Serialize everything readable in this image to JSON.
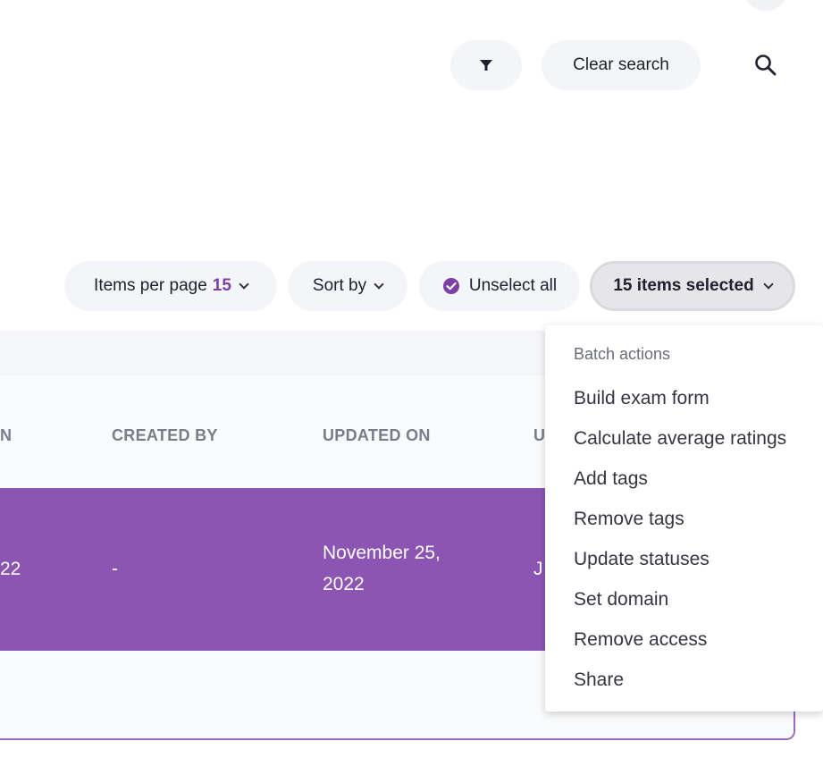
{
  "toolbar": {
    "filter_icon": "filter-icon",
    "clear_label": "Clear search",
    "search_icon": "search-icon"
  },
  "controls": {
    "items_per_page_label": "Items per page",
    "items_per_page_value": "15",
    "sort_label": "Sort by",
    "unselect_label": "Unselect all",
    "selected_label": "15 items selected"
  },
  "table": {
    "columns": [
      "N",
      "CREATED BY",
      "UPDATED ON",
      "U"
    ],
    "rows": [
      {
        "created_on": "22",
        "created_by": "-",
        "updated_on_line1": "November 25,",
        "updated_on_line2": "2022",
        "updated_by": "J"
      }
    ]
  },
  "batch_menu": {
    "header": "Batch actions",
    "items": [
      "Build exam form",
      "Calculate average ratings",
      "Add tags",
      "Remove tags",
      "Update statuses",
      "Set domain",
      "Remove access",
      "Share"
    ]
  },
  "colors": {
    "accent": "#7b3fa6",
    "selected_row": "#8c55b3"
  }
}
